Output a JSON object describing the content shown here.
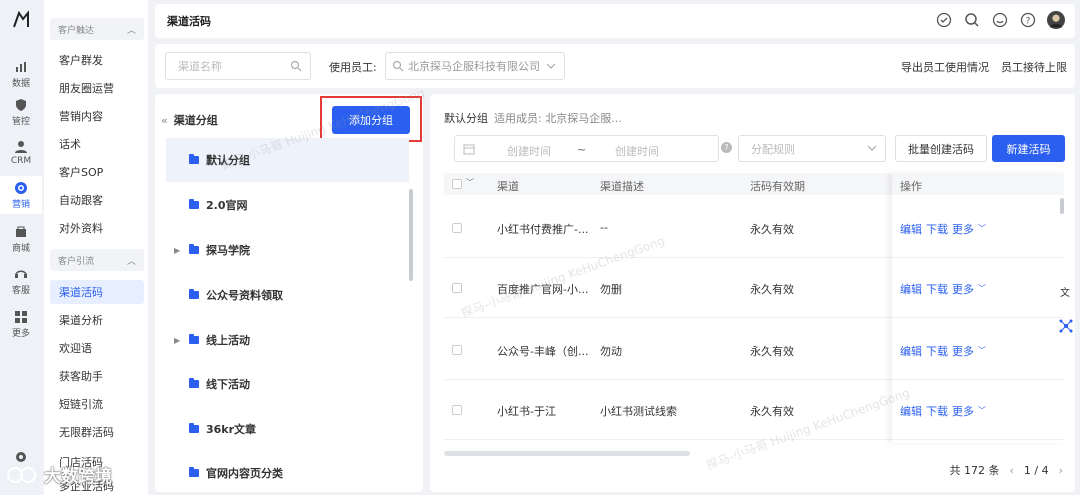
{
  "rail": {
    "items": [
      {
        "label": "数据",
        "icon": "bar-chart-icon"
      },
      {
        "label": "管控",
        "icon": "shield-icon"
      },
      {
        "label": "CRM",
        "icon": "user-icon"
      },
      {
        "label": "营销",
        "icon": "target-icon"
      },
      {
        "label": "商城",
        "icon": "shop-icon"
      },
      {
        "label": "客服",
        "icon": "headset-icon"
      },
      {
        "label": "更多",
        "icon": "grid-icon"
      }
    ],
    "active": "营销"
  },
  "subnav": {
    "group1": "客户触达",
    "group1_items": [
      "客户群发",
      "朋友圈运营",
      "营销内容",
      "话术",
      "客户SOP",
      "自动跟客",
      "对外资料"
    ],
    "group2": "客户引流",
    "group2_items": [
      "渠道活码",
      "渠道分析",
      "欢迎语",
      "获客助手",
      "短链引流",
      "无限群活码",
      "门店活码",
      "多企业活码"
    ],
    "active": "渠道活码"
  },
  "topbar": {
    "title": "渠道活码"
  },
  "filters": {
    "search_placeholder": "渠道名称",
    "staff_label": "使用员工:",
    "staff_value": "北京探马企服科技有限公司",
    "export_link": "导出员工使用情况",
    "limit_link": "员工接待上限"
  },
  "groups": {
    "header": "渠道分组",
    "add_button": "添加分组",
    "items": [
      {
        "label": "默认分组",
        "active": true,
        "expandable": false
      },
      {
        "label": "2.0官网",
        "active": false,
        "expandable": false
      },
      {
        "label": "探马学院",
        "active": false,
        "expandable": true
      },
      {
        "label": "公众号资料领取",
        "active": false,
        "expandable": false
      },
      {
        "label": "线上活动",
        "active": false,
        "expandable": true
      },
      {
        "label": "线下活动",
        "active": false,
        "expandable": false
      },
      {
        "label": "36kr文章",
        "active": false,
        "expandable": false
      },
      {
        "label": "官网内容页分类",
        "active": false,
        "expandable": false
      }
    ]
  },
  "table_panel": {
    "group_title": "默认分组",
    "members": "适用成员: 北京探马企服...",
    "date_start_placeholder": "创建时间",
    "date_sep": "~",
    "date_end_placeholder": "创建时间",
    "rule_placeholder": "分配规则",
    "batch_button": "批量创建活码",
    "new_button": "新建活码",
    "columns": [
      "渠道",
      "渠道描述",
      "活码有效期",
      "操作"
    ],
    "rows": [
      {
        "channel": "小红书付费推广-...",
        "desc": "--",
        "validity": "永久有效"
      },
      {
        "channel": "百度推广官网-小...",
        "desc": "勿删",
        "validity": "永久有效"
      },
      {
        "channel": "公众号-丰峰（创...",
        "desc": "勿动",
        "validity": "永久有效"
      },
      {
        "channel": "小红书-于江",
        "desc": "小红书测试线索",
        "validity": "永久有效"
      }
    ],
    "actions": {
      "edit": "编辑",
      "download": "下载",
      "more": "更多"
    },
    "total": "共 172 条",
    "page": "1 / 4"
  },
  "watermark": {
    "brand": "大数跨境",
    "tile": "探马-小马哥 Huijing KeHuChengGong"
  },
  "colors": {
    "primary": "#2b5ff0",
    "highlight": "#e53935"
  }
}
